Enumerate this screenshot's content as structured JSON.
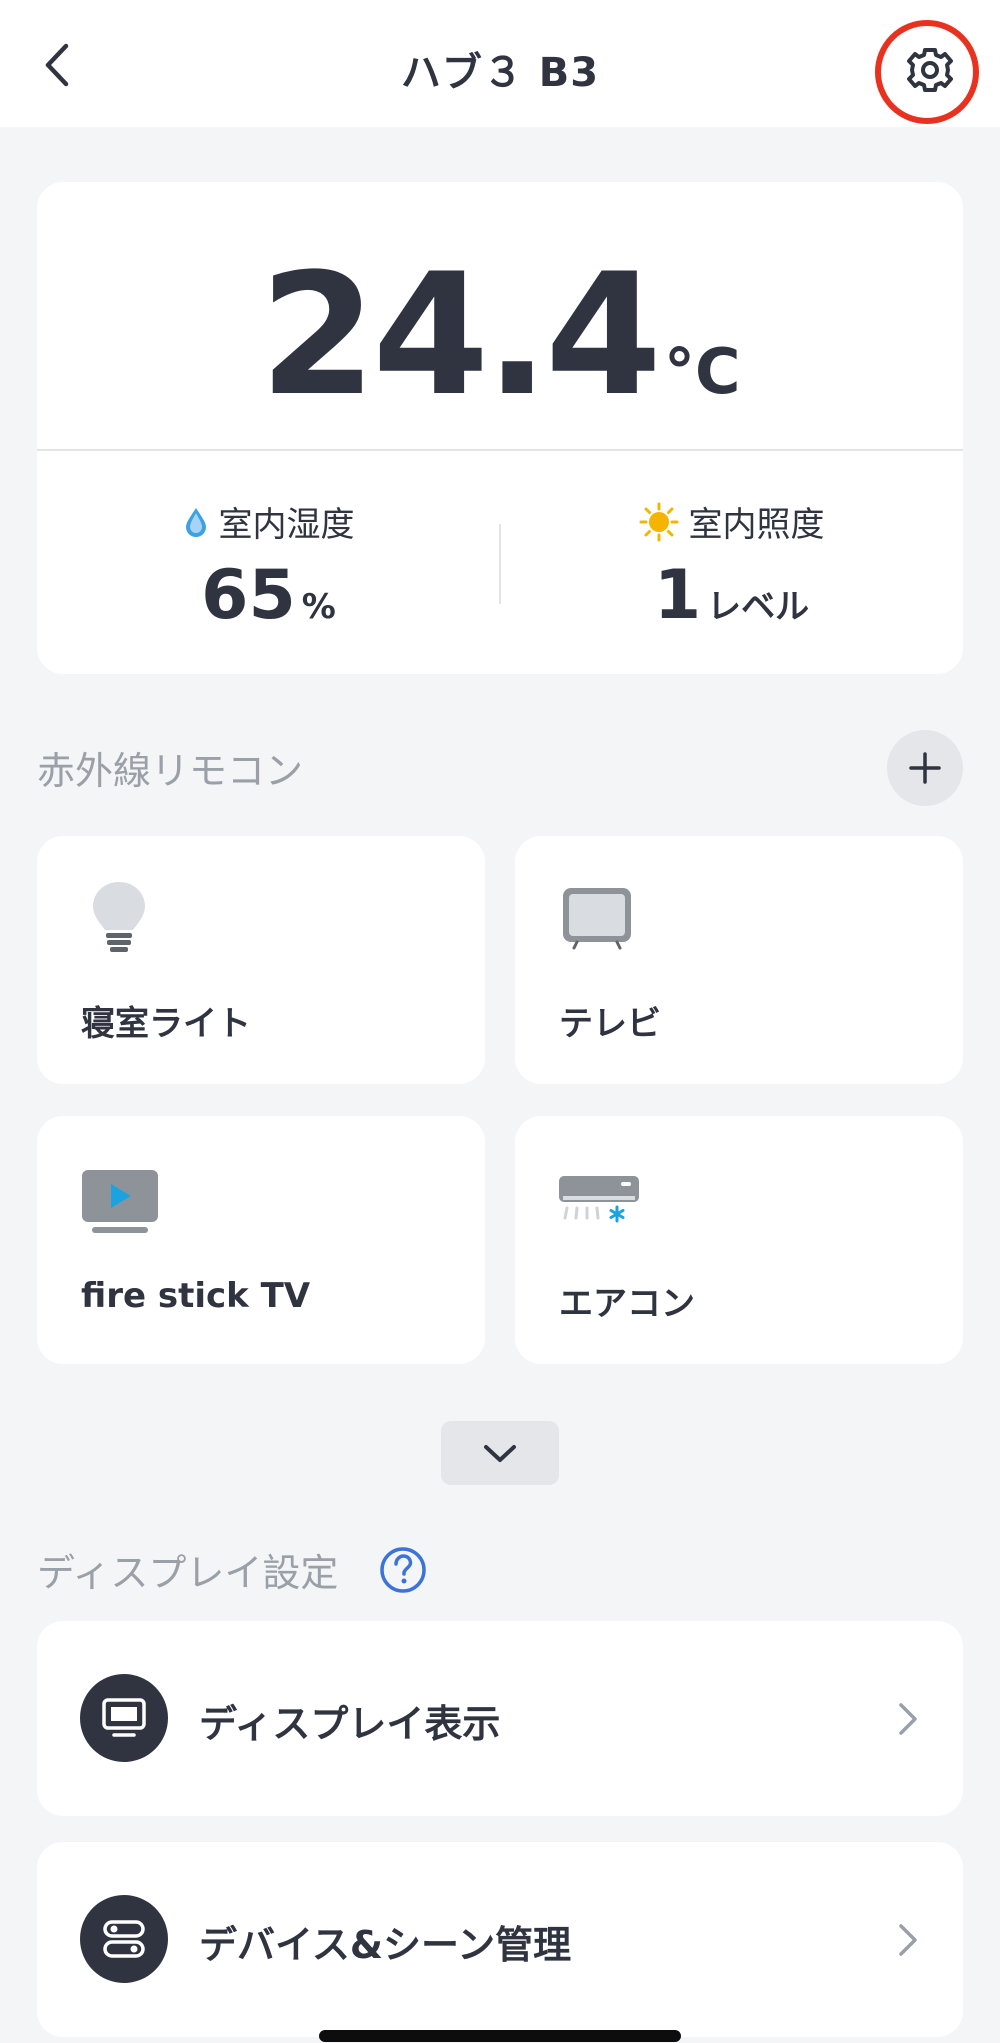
{
  "header": {
    "title": "ハブ３ B3"
  },
  "temperature": {
    "value": "24.4",
    "unit": "°C"
  },
  "humidity": {
    "label": "室内湿度",
    "value": "65",
    "unit": "%"
  },
  "illuminance": {
    "label": "室内照度",
    "value": "1",
    "unit": "レベル"
  },
  "ir_remote": {
    "title": "赤外線リモコン",
    "devices": [
      {
        "label": "寝室ライト",
        "icon": "light-bulb-icon"
      },
      {
        "label": "テレビ",
        "icon": "tv-icon"
      },
      {
        "label": "fire stick TV",
        "icon": "streaming-player-icon"
      },
      {
        "label": "エアコン",
        "icon": "air-conditioner-icon"
      }
    ]
  },
  "display_settings": {
    "title": "ディスプレイ設定",
    "rows": [
      {
        "label": "ディスプレイ表示",
        "icon": "display-icon"
      },
      {
        "label": "デバイス&シーン管理",
        "icon": "device-scene-icon"
      }
    ]
  },
  "colors": {
    "accent": "#e8321f",
    "text": "#2f3440",
    "muted": "#9aa0a8",
    "background": "#f4f5f7",
    "link_blue": "#3b73d9",
    "humidity_blue": "#3da1e6",
    "sun_yellow": "#f5b400"
  }
}
